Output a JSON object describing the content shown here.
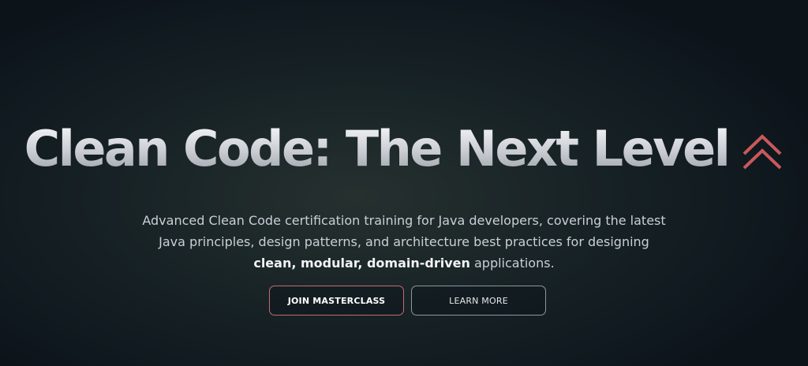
{
  "hero": {
    "title": "Clean Code: The Next Level",
    "title_icon": "double-chevron-up-icon",
    "description": {
      "line1": "Advanced Clean Code certification training for Java developers, covering the latest Java principles, design patterns, and architecture best practices for designing",
      "emphasis": "clean, modular, domain-driven",
      "line_end": " applications."
    },
    "buttons": {
      "primary_label": "JOIN MASTERCLASS",
      "secondary_label": "LEARN MORE"
    }
  },
  "colors": {
    "accent": "#c9585c",
    "primary_button_border": "#c46a6e",
    "secondary_button_border": "#8f969d",
    "background": "#152024"
  }
}
